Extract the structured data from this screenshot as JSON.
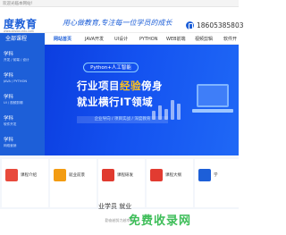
{
  "topbar": {
    "text": "欢迎光临本网站！"
  },
  "header": {
    "logo": "度教育",
    "logo_sub": "www.xdsjpx-edu.com",
    "slogan": "用心做教育,专注每一位学员的成长",
    "phone": "18605385803"
  },
  "nav": {
    "all_courses": "全部课程",
    "items": [
      "网站首页",
      "JAVA开发",
      "UI设计",
      "PYTHON",
      "WEB前端",
      "视频剪辑",
      "软件开"
    ]
  },
  "sidebar": {
    "items": [
      {
        "label": "学科",
        "sub": "开发 / 前端 / 设计"
      },
      {
        "label": "学科",
        "sub": "JAVA / PYTHON"
      },
      {
        "label": "学科",
        "sub": "UI / 视频剪辑"
      },
      {
        "label": "学科",
        "sub": "软件开发"
      },
      {
        "label": "学科",
        "sub": "网络营销"
      }
    ]
  },
  "banner": {
    "tag": "Python+人工智能",
    "headline1_a": "行业项目",
    "headline1_hl": "经验",
    "headline1_b": "傍身",
    "headline2": "就业横行IT领域",
    "subline": "企业导向 / 项目实战 / 深度教育"
  },
  "cards": [
    {
      "label": "课程介绍",
      "color": "#e84a3c"
    },
    {
      "label": "就业前景",
      "color": "#f39c12"
    },
    {
      "label": "课程研发",
      "color": "#e03a2f"
    },
    {
      "label": "课程大纲",
      "color": "#e23b31"
    },
    {
      "label": "学",
      "color": "#1d5fd8"
    }
  ],
  "section": {
    "title": "业学员  就业",
    "sub": "勤奋越努力越幸运"
  },
  "watermark": "免费收录网"
}
